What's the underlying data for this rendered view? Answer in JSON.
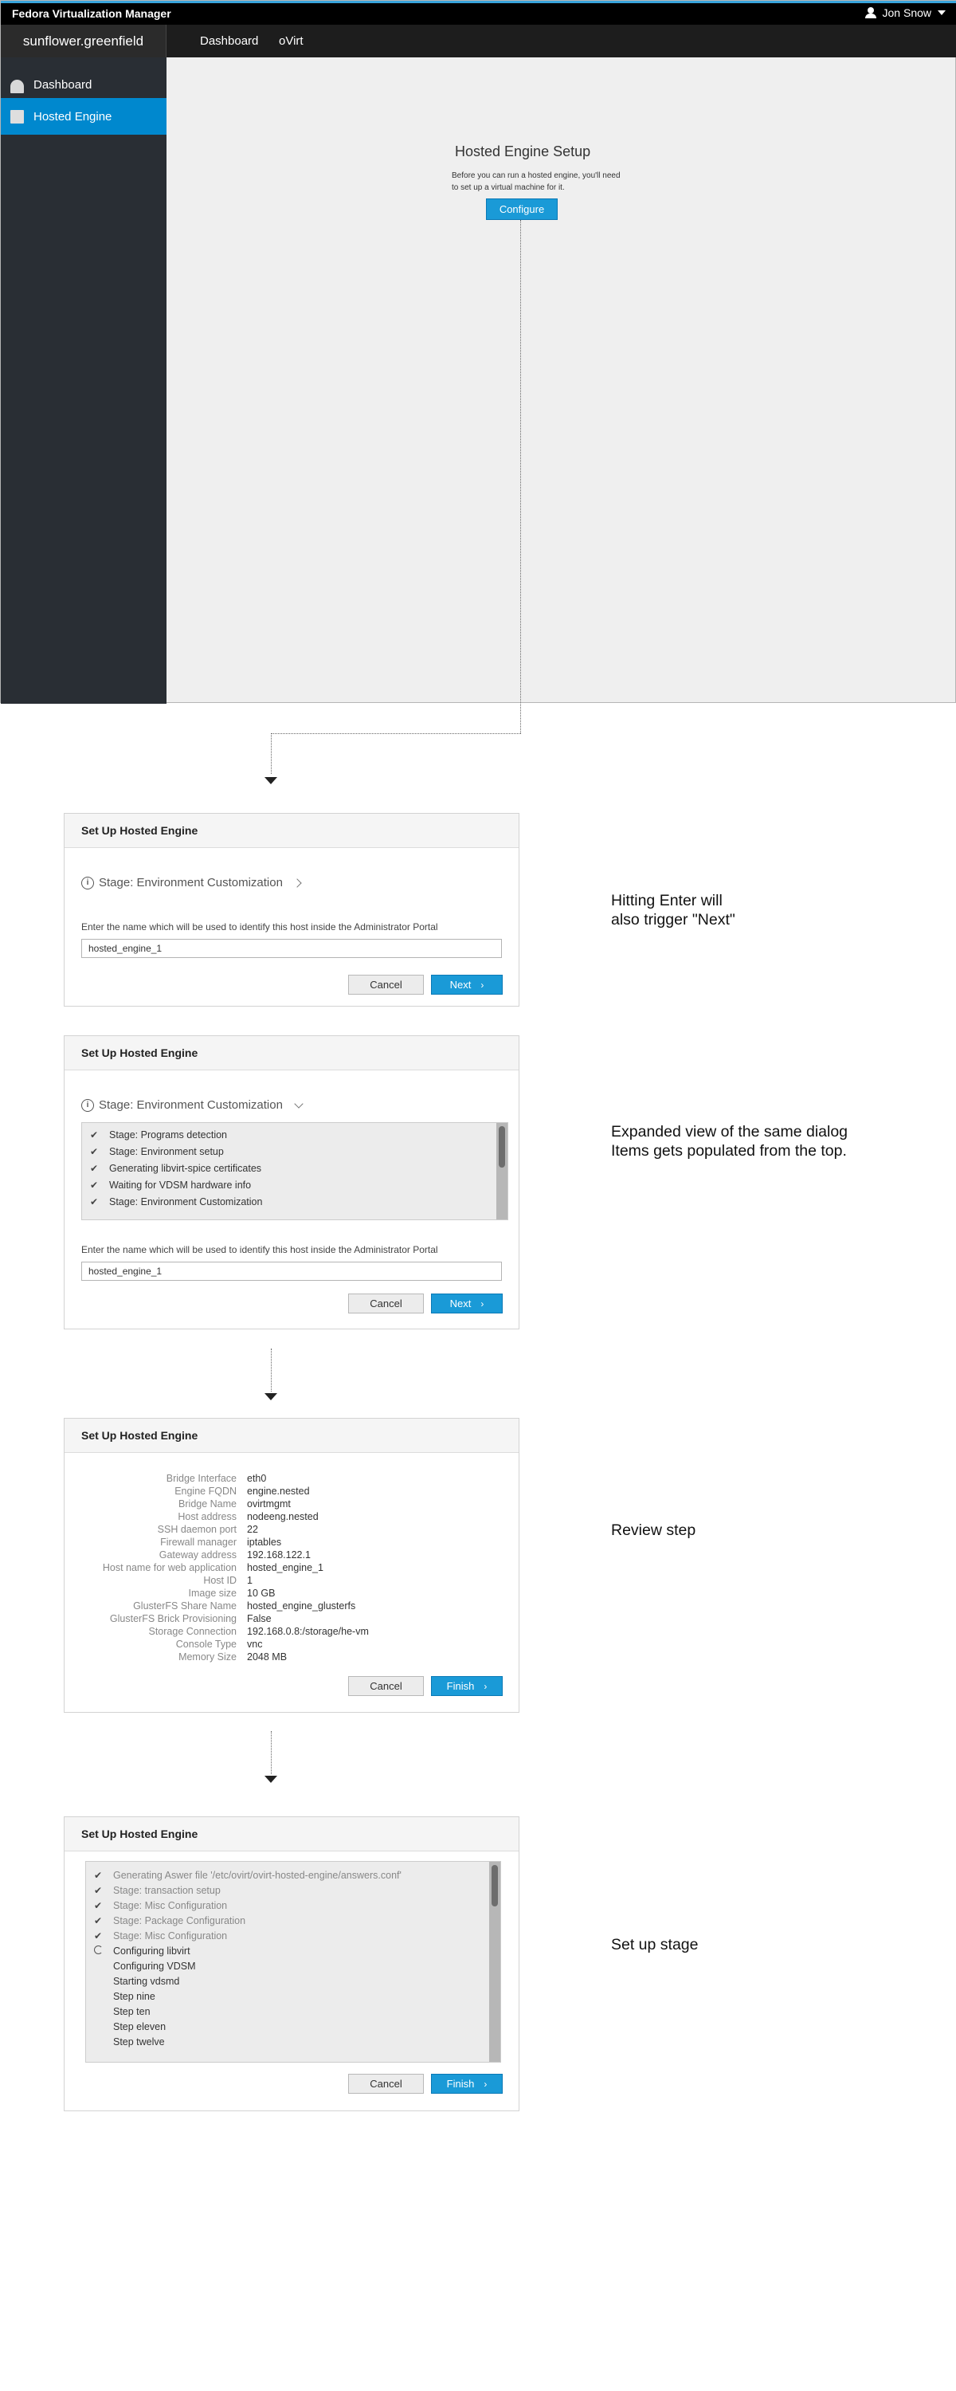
{
  "app": {
    "brand": "Fedora Virtualization Manager",
    "user_name": "Jon Snow",
    "host_name": "sunflower.greenfield",
    "nav": [
      "Dashboard",
      "oVirt"
    ],
    "sidebar": [
      {
        "label": "Dashboard",
        "icon": "dashboard-icon",
        "active": false
      },
      {
        "label": "Hosted Engine",
        "icon": "hosted-engine-icon",
        "active": true
      }
    ],
    "setup": {
      "title": "Hosted Engine Setup",
      "desc": "Before you can run a hosted engine, you'll need to set up a virtual machine for it.",
      "configure_label": "Configure"
    },
    "colors": {
      "accent": "#0088ce",
      "topbar": "#000000",
      "sidebar": "#292e34"
    }
  },
  "dialog1": {
    "title": "Set Up Hosted Engine",
    "stage": "Stage: Environment Customization",
    "field_label": "Enter the name which will be used to identify this host inside the Administrator Portal",
    "field_value": "hosted_engine_1",
    "cancel": "Cancel",
    "next": "Next"
  },
  "dialog2": {
    "title": "Set Up Hosted Engine",
    "stage": "Stage: Environment Customization",
    "log": [
      "Stage: Programs detection",
      "Stage: Environment setup",
      "Generating libvirt-spice certificates",
      "Waiting for VDSM hardware info",
      "Stage: Environment Customization"
    ],
    "field_label": "Enter the name which will be used to identify this host inside the Administrator Portal",
    "field_value": "hosted_engine_1",
    "cancel": "Cancel",
    "next": "Next"
  },
  "dialog3": {
    "title": "Set Up Hosted Engine",
    "rows": [
      {
        "label": "Bridge Interface",
        "value": "eth0"
      },
      {
        "label": "Engine FQDN",
        "value": "engine.nested"
      },
      {
        "label": "Bridge Name",
        "value": "ovirtmgmt"
      },
      {
        "label": "Host address",
        "value": "nodeeng.nested"
      },
      {
        "label": "SSH daemon port",
        "value": "22"
      },
      {
        "label": "Firewall manager",
        "value": "iptables"
      },
      {
        "label": "Gateway address",
        "value": "192.168.122.1"
      },
      {
        "label": "Host name for web application",
        "value": "hosted_engine_1"
      },
      {
        "label": "Host ID",
        "value": "1"
      },
      {
        "label": "Image size",
        "value": "10 GB"
      },
      {
        "label": "GlusterFS Share Name",
        "value": "hosted_engine_glusterfs"
      },
      {
        "label": "GlusterFS Brick Provisioning",
        "value": "False"
      },
      {
        "label": "Storage Connection",
        "value": "192.168.0.8:/storage/he-vm"
      },
      {
        "label": "Console Type",
        "value": "vnc"
      },
      {
        "label": "Memory Size",
        "value": "2048 MB"
      }
    ],
    "cancel": "Cancel",
    "finish": "Finish"
  },
  "dialog4": {
    "title": "Set Up Hosted Engine",
    "log": [
      {
        "text": "Generating Aswer file '/etc/ovirt/ovirt-hosted-engine/answers.conf'",
        "status": "done"
      },
      {
        "text": "Stage: transaction setup",
        "status": "done"
      },
      {
        "text": "Stage: Misc Configuration",
        "status": "done"
      },
      {
        "text": "Stage: Package Configuration",
        "status": "done"
      },
      {
        "text": "Stage: Misc Configuration",
        "status": "done"
      },
      {
        "text": "Configuring libvirt",
        "status": "running"
      },
      {
        "text": "Configuring VDSM",
        "status": "pending"
      },
      {
        "text": "Starting vdsmd",
        "status": "pending"
      },
      {
        "text": "Step nine",
        "status": "pending"
      },
      {
        "text": "Step ten",
        "status": "pending"
      },
      {
        "text": "Step eleven",
        "status": "pending"
      },
      {
        "text": "Step twelve",
        "status": "pending"
      }
    ],
    "cancel": "Cancel",
    "finish": "Finish"
  },
  "notes": {
    "note1_line1": "Hitting Enter will",
    "note1_line2": "also trigger \"Next\"",
    "note2_line1": "Expanded view of the same dialog",
    "note2_line2": "Items gets populated from the top.",
    "note3": "Review step",
    "note4": "Set up stage"
  }
}
